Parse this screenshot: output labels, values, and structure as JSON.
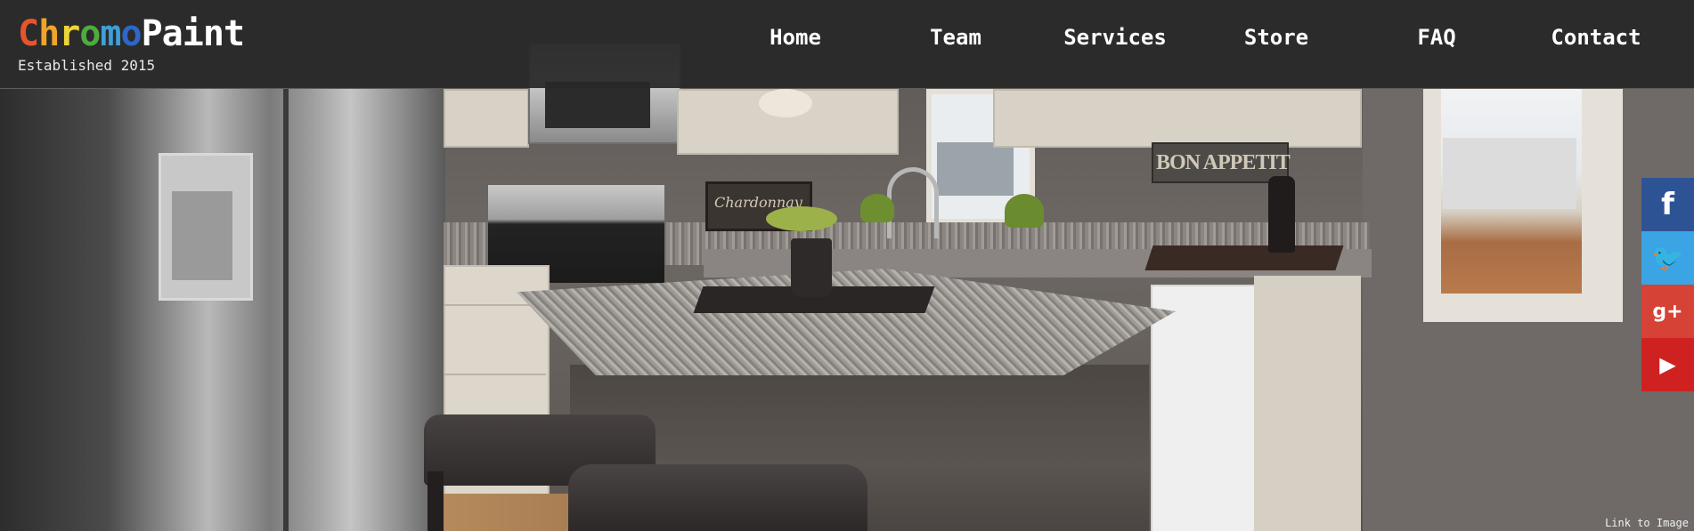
{
  "brand": {
    "logo_letters": [
      {
        "char": "C",
        "color": "#e8542c"
      },
      {
        "char": "h",
        "color": "#f0a428"
      },
      {
        "char": "r",
        "color": "#ecd53a"
      },
      {
        "char": "o",
        "color": "#4faa3f"
      },
      {
        "char": "m",
        "color": "#3f9fd8"
      },
      {
        "char": "o",
        "color": "#2e66c9"
      },
      {
        "char": "P",
        "color": "#ffffff"
      },
      {
        "char": "a",
        "color": "#ffffff"
      },
      {
        "char": "i",
        "color": "#ffffff"
      },
      {
        "char": "n",
        "color": "#ffffff"
      },
      {
        "char": "t",
        "color": "#ffffff"
      }
    ],
    "tagline": "Established 2015"
  },
  "nav": {
    "items": [
      {
        "label": "Home"
      },
      {
        "label": "Team"
      },
      {
        "label": "Services"
      },
      {
        "label": "Store"
      },
      {
        "label": "FAQ"
      },
      {
        "label": "Contact"
      }
    ]
  },
  "hero": {
    "sign_text": "BON APPETIT",
    "picture_text": "Chardonnay",
    "image_link": "Link to Image"
  },
  "social": [
    {
      "name": "facebook",
      "icon": "facebook-icon",
      "glyph": "f",
      "color": "#2e5395"
    },
    {
      "name": "twitter",
      "icon": "twitter-icon",
      "glyph": "🐦",
      "color": "#3aa4e4"
    },
    {
      "name": "google-plus",
      "icon": "google-plus-icon",
      "glyph": "g+",
      "color": "#d64236"
    },
    {
      "name": "youtube",
      "icon": "youtube-icon",
      "glyph": "▶",
      "color": "#cf2220"
    }
  ]
}
